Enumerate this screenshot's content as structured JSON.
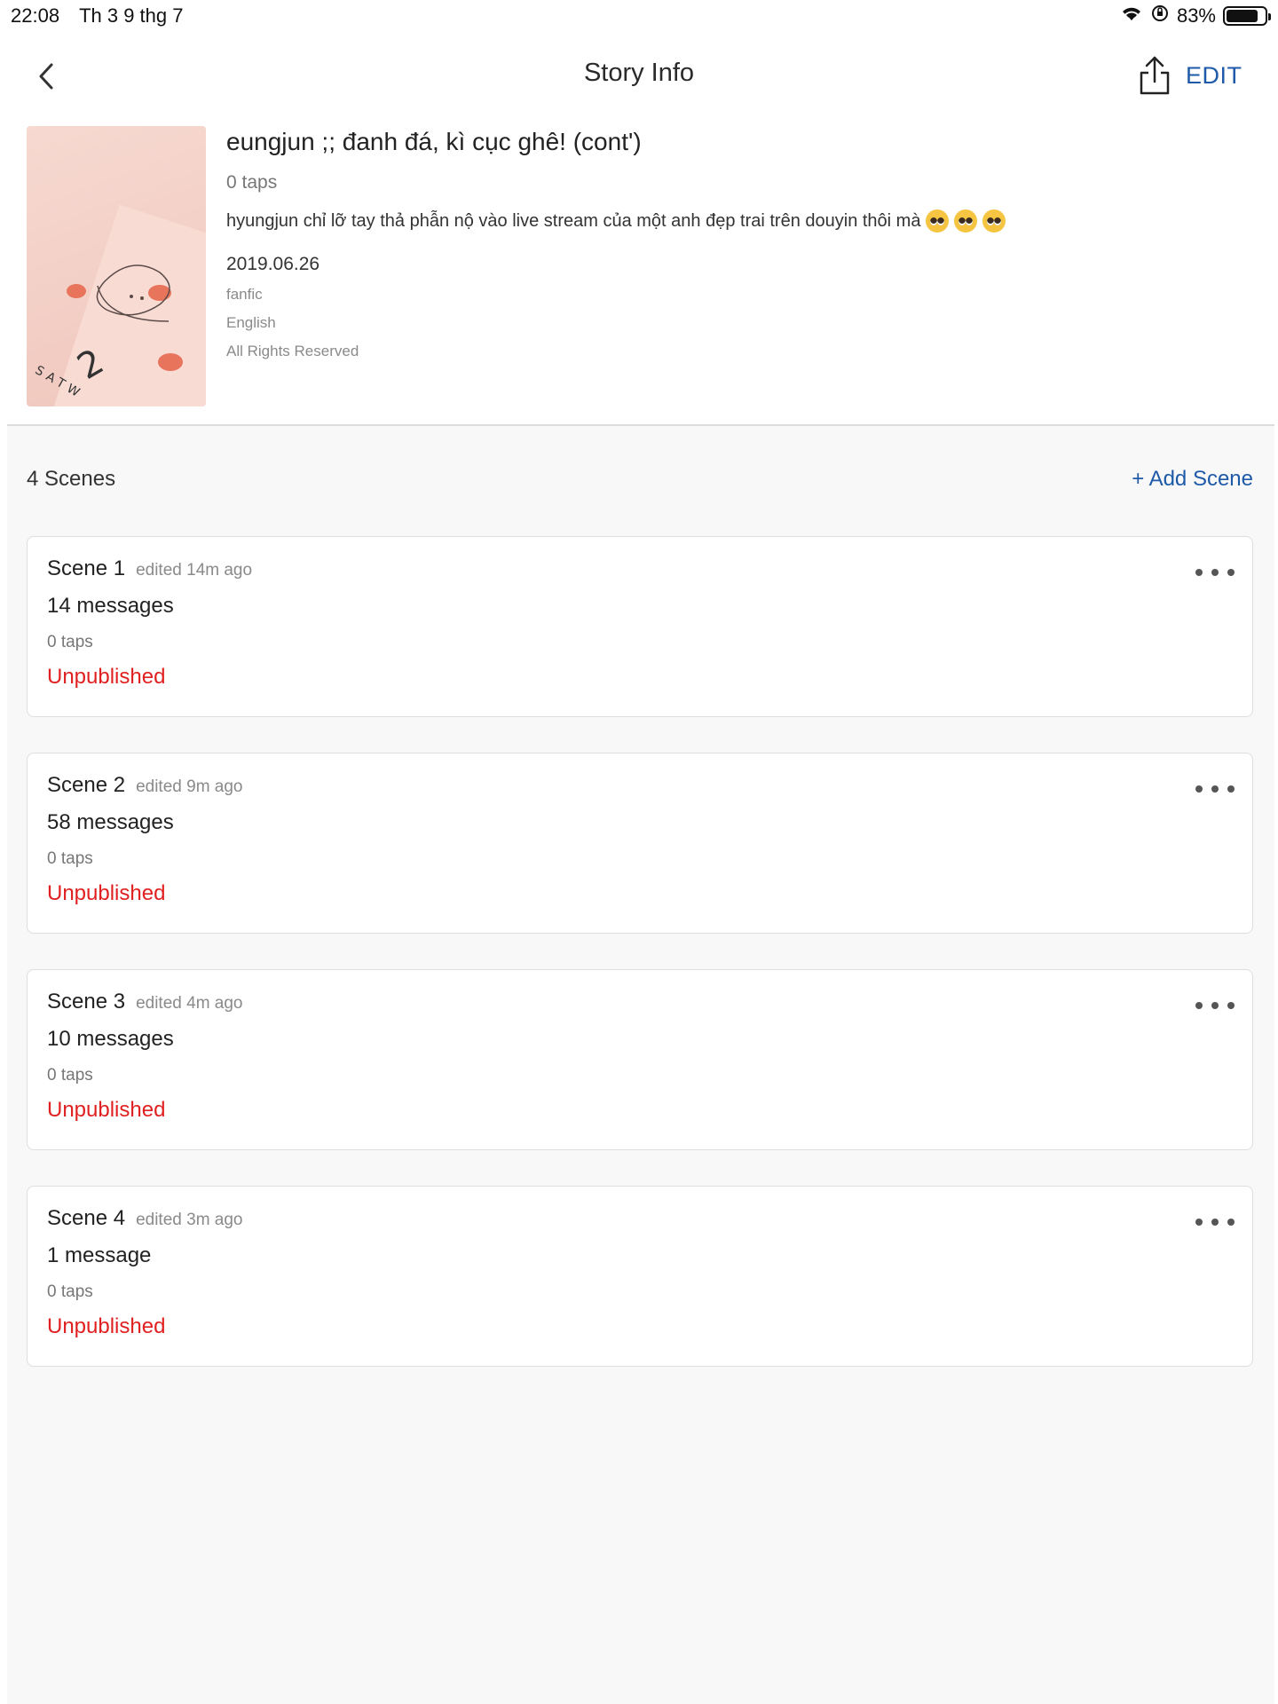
{
  "status_bar": {
    "time": "22:08",
    "date": "Th 3 9 thg 7",
    "battery_text": "83%",
    "battery_level": 0.83,
    "icons": [
      "wifi-icon",
      "orientation-lock-icon",
      "battery-icon"
    ]
  },
  "nav": {
    "title": "Story Info",
    "back_icon": "chevron-left-icon",
    "share_icon": "share-icon",
    "edit_label": "EDIT"
  },
  "story": {
    "title": "eungjun ;; đanh đá, kì cục ghê! (cont')",
    "taps": "0 taps",
    "description": "hyungjun chỉ lỡ tay thả phẫn nộ vào live stream của một anh đẹp trai trên douyin thôi mà",
    "description_emojis": [
      "pleading-face",
      "pleading-face",
      "pleading-face"
    ],
    "date": "2019.06.26",
    "category": "fanfic",
    "language": "English",
    "rights": "All Rights Reserved",
    "cover_text": {
      "number": "2",
      "brand": "SATW"
    }
  },
  "scenes_section": {
    "count_label": "4 Scenes",
    "add_label": "+ Add Scene",
    "scenes": [
      {
        "name": "Scene 1",
        "edited": "edited 14m ago",
        "messages": "14 messages",
        "taps": "0 taps",
        "status": "Unpublished"
      },
      {
        "name": "Scene 2",
        "edited": "edited 9m ago",
        "messages": "58 messages",
        "taps": "0 taps",
        "status": "Unpublished"
      },
      {
        "name": "Scene 3",
        "edited": "edited 4m ago",
        "messages": "10 messages",
        "taps": "0 taps",
        "status": "Unpublished"
      },
      {
        "name": "Scene 4",
        "edited": "edited 3m ago",
        "messages": "1 message",
        "taps": "0 taps",
        "status": "Unpublished"
      }
    ]
  },
  "colors": {
    "accent": "#1e5aa8",
    "unpublished": "#e02020",
    "background": "#f8f8f8"
  }
}
